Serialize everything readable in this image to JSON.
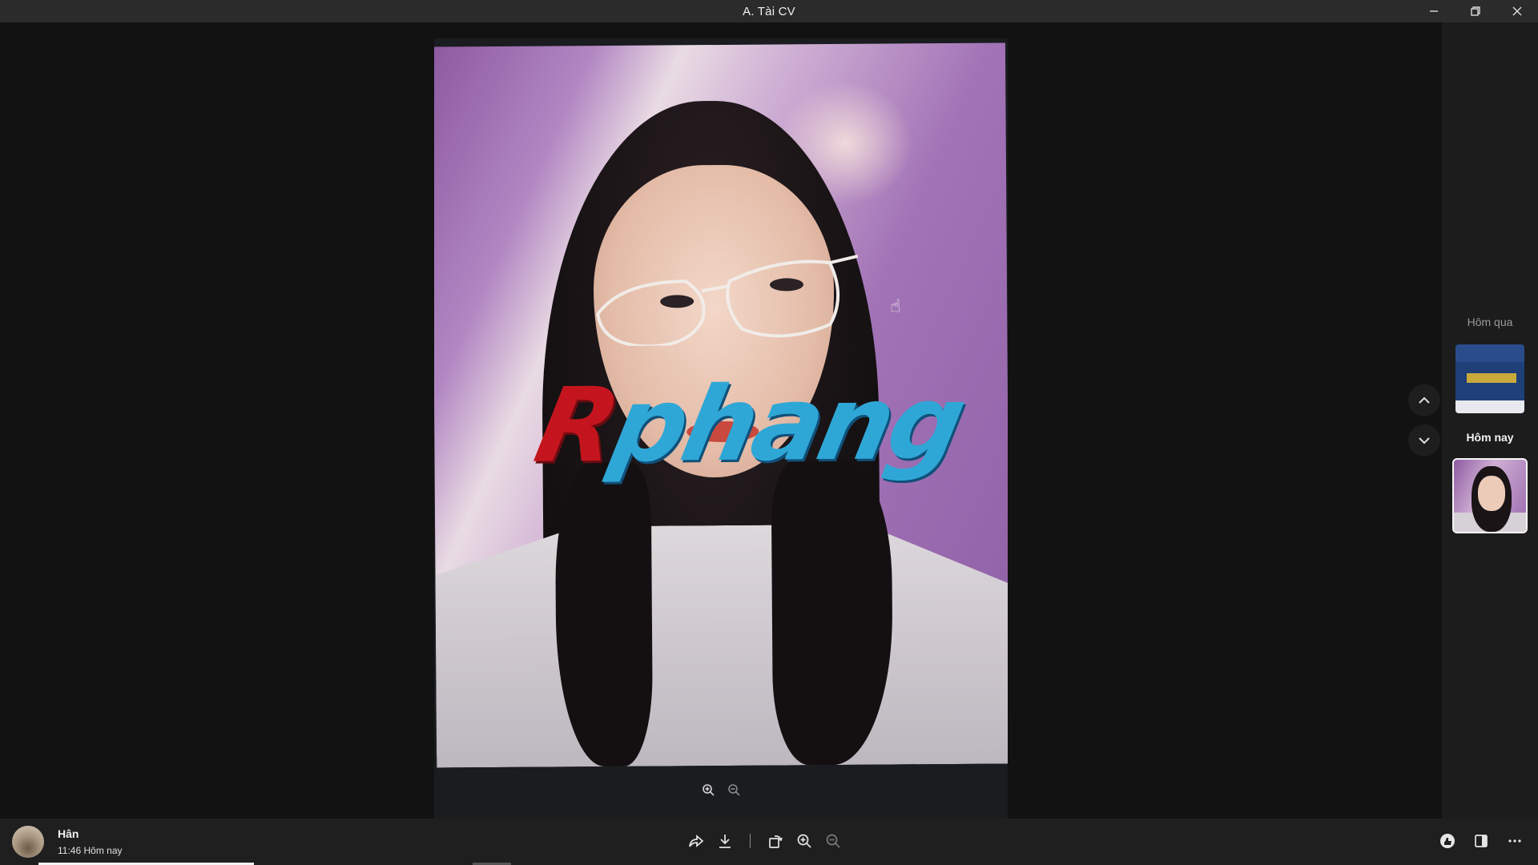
{
  "window": {
    "title": "A. Tài CV",
    "controls": [
      "minimize-icon",
      "restore-icon",
      "close-icon"
    ]
  },
  "viewer": {
    "watermark_part1": "R",
    "watermark_part2": "phang",
    "frame_zoom_icons": [
      "zoom-in-icon",
      "zoom-out-icon"
    ]
  },
  "sidepanel": {
    "groups": [
      {
        "label": "Hôm qua"
      },
      {
        "label": "Hôm nay"
      }
    ],
    "nav": [
      "chevron-up-icon",
      "chevron-down-icon"
    ]
  },
  "footer": {
    "sender_name": "Hân",
    "timestamp": "11:46 Hôm nay",
    "toolbar_icons": [
      "share-icon",
      "download-icon",
      "rotate-icon",
      "zoom-in-icon",
      "zoom-out-icon"
    ],
    "right_icons": [
      "reaction-icon",
      "panel-toggle-icon",
      "more-icon"
    ],
    "progress_fraction": 0.14
  },
  "colors": {
    "titlebar_bg": "#2b2b2b",
    "viewer_bg": "#121212",
    "panel_bg": "#1c1c1c",
    "footer_bg": "#1f1f1f",
    "watermark_red": "#c4151e",
    "watermark_blue": "#2fa7d6"
  }
}
